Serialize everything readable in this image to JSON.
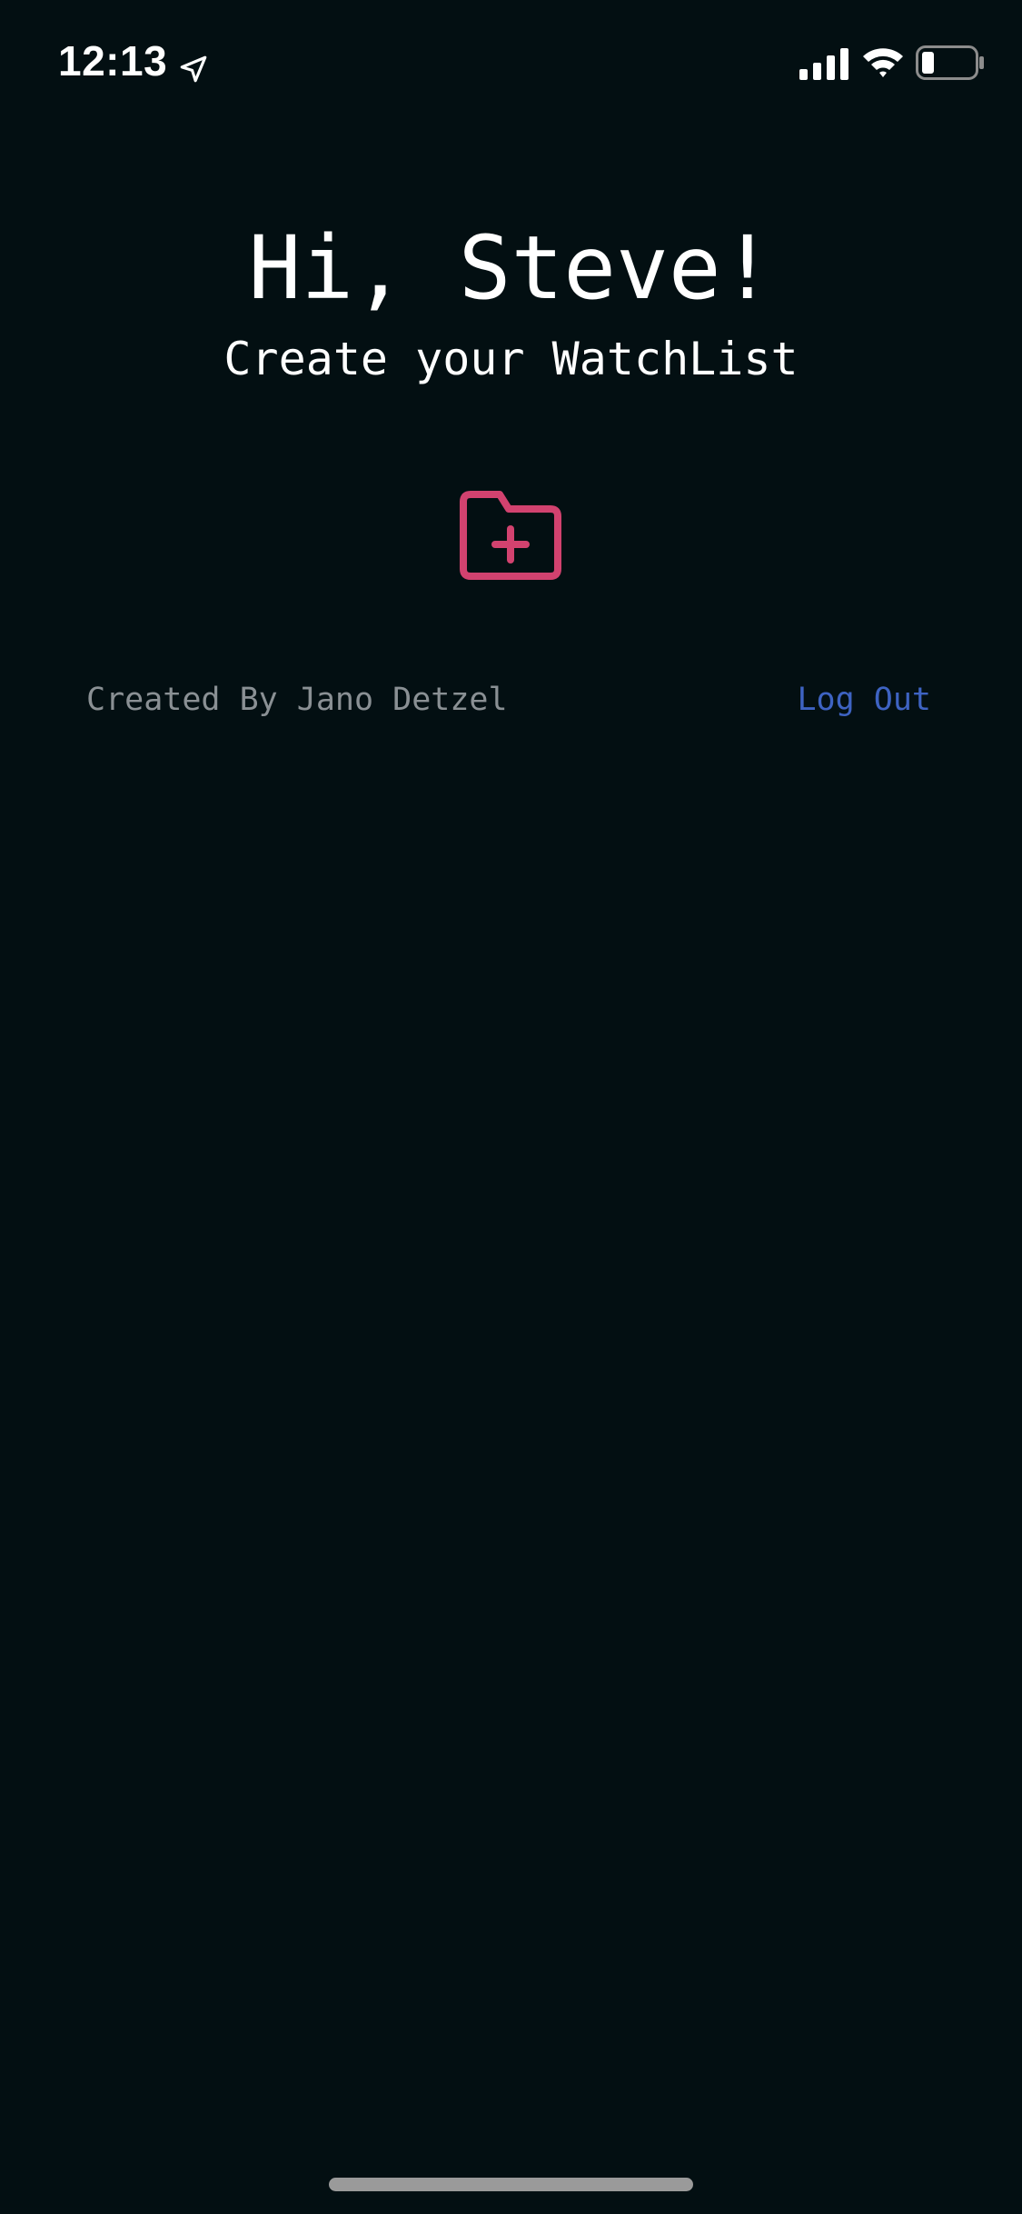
{
  "status_bar": {
    "time": "12:13",
    "icons": [
      "location-arrow-icon",
      "cellular-signal-icon",
      "wifi-icon",
      "battery-icon"
    ]
  },
  "main": {
    "greeting": "Hi, Steve!",
    "subtitle": "Create your WatchList",
    "create_folder_icon": "folder-plus-icon"
  },
  "footer": {
    "credit": "Created By Jano Detzel",
    "logout_label": "Log Out"
  },
  "colors": {
    "background": "#030f12",
    "accent": "#d2426f",
    "link": "#3e63c2",
    "muted_text": "#8a9094"
  }
}
